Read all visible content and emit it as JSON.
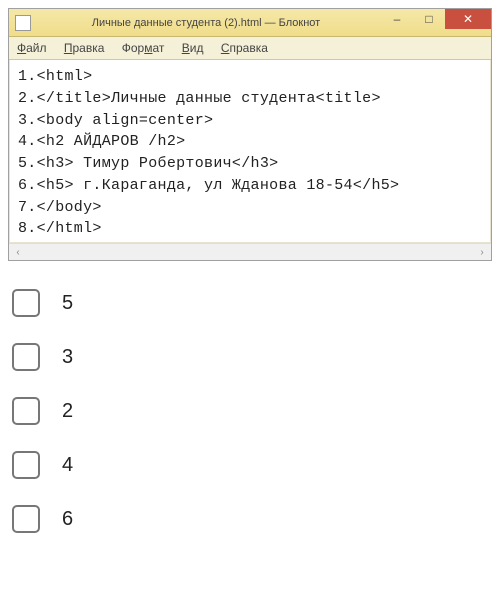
{
  "window": {
    "title": "Личные данные студента (2).html — Блокнот",
    "controls": {
      "minimize": "–",
      "maximize": "□",
      "close": "✕"
    }
  },
  "menu": {
    "items": [
      {
        "label": "Файл",
        "accel_index": 0
      },
      {
        "label": "Правка",
        "accel_index": 0
      },
      {
        "label": "Формат",
        "accel_index": 0
      },
      {
        "label": "Вид",
        "accel_index": 0
      },
      {
        "label": "Справка",
        "accel_index": 0
      }
    ]
  },
  "editor": {
    "lines": [
      "1.<html>",
      "2.</title>Личные данные студента<title>",
      "3.<body align=center>",
      "4.<h2 АЙДАРОВ /h2>",
      "5.<h3> Тимур Робертович</h3>",
      "6.<h5> г.Караганда, ул Жданова 18-54</h5>",
      "7.</body>",
      "8.</html>"
    ]
  },
  "scrollbar": {
    "left": "‹",
    "right": "›"
  },
  "options": [
    {
      "label": "5"
    },
    {
      "label": "3"
    },
    {
      "label": "2"
    },
    {
      "label": "4"
    },
    {
      "label": "6"
    }
  ]
}
